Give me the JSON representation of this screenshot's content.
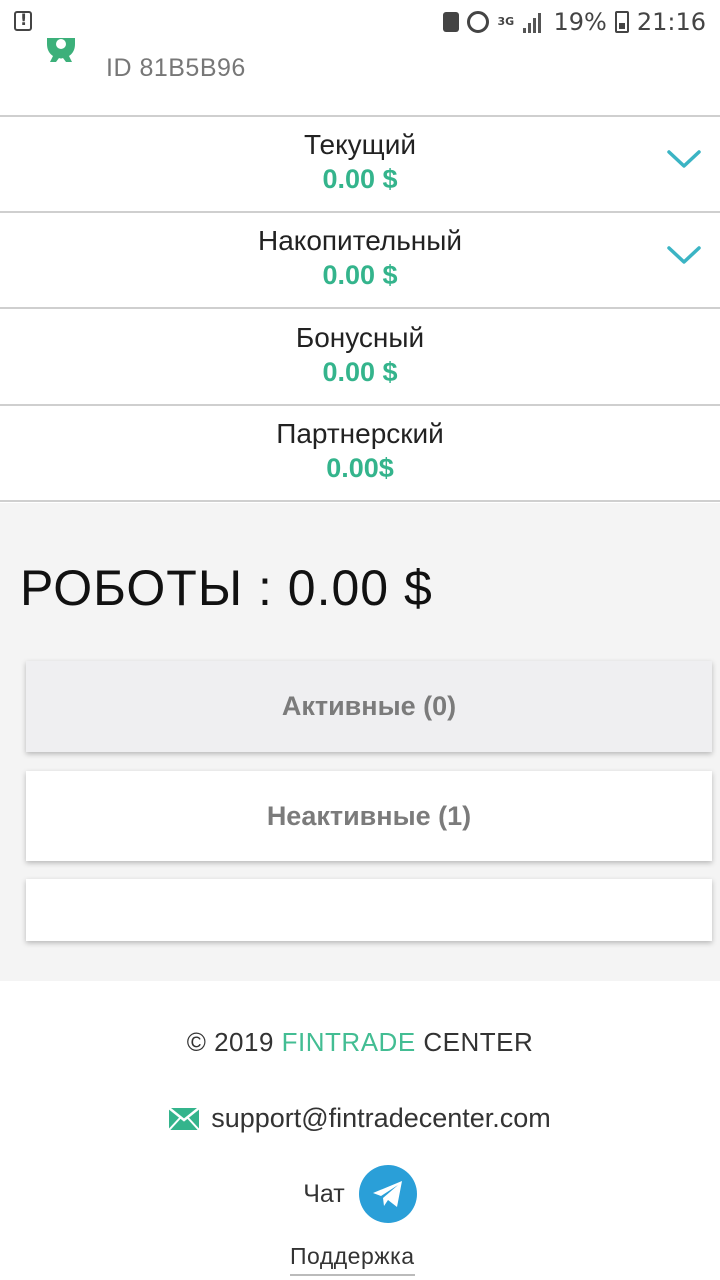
{
  "status_bar": {
    "network": "3G",
    "battery": "19%",
    "time": "21:16"
  },
  "header": {
    "user_id": "ID 81B5B96"
  },
  "accounts": [
    {
      "name": "Текущий",
      "value": "0.00 $",
      "expandable": true
    },
    {
      "name": "Накопительный",
      "value": "0.00 $",
      "expandable": true
    },
    {
      "name": "Бонусный",
      "value": "0.00 $",
      "expandable": false
    },
    {
      "name": "Партнерский",
      "value": "0.00$",
      "expandable": false
    }
  ],
  "robots": {
    "title": "РОБОТЫ : 0.00 $",
    "tabs": [
      {
        "label": "Активные (0)"
      },
      {
        "label": "Неактивные (1)"
      },
      {
        "label": ""
      }
    ]
  },
  "footer": {
    "copyright_prefix": "© 2019 ",
    "brand_accent": "FINTRADE",
    "brand_rest": " CENTER",
    "email": "support@fintradecenter.com",
    "chat_label": "Чат",
    "support_link": "Поддержка"
  },
  "colors": {
    "accent": "#34b48c",
    "telegram": "#2a9fd8",
    "chevron": "#3bb4c4"
  },
  "icons": {
    "header": "gear-icon",
    "email": "mail-icon",
    "chat": "telegram-icon"
  }
}
